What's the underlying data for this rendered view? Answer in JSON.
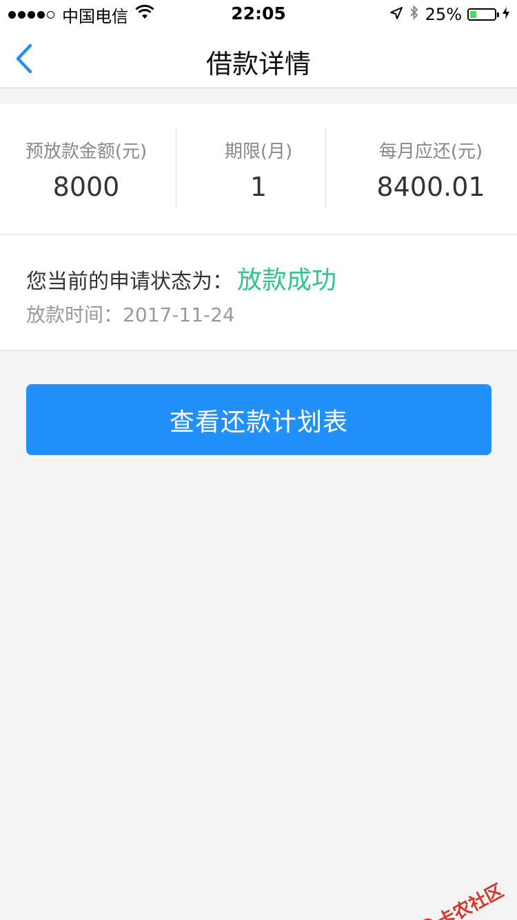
{
  "status_bar": {
    "carrier": "中国电信",
    "time": "22:05",
    "battery_percent": "25%",
    "battery_level": 0.25,
    "signal_bars": 4,
    "signal_total": 5
  },
  "nav": {
    "title": "借款详情"
  },
  "summary": [
    {
      "label": "预放款金额(元)",
      "value": "8000"
    },
    {
      "label": "期限(月)",
      "value": "1"
    },
    {
      "label": "每月应还(元)",
      "value": "8400.01"
    }
  ],
  "status": {
    "label": "您当前的申请状态为：",
    "value": "放款成功",
    "time_label": "放款时间：",
    "time_value": "2017-11-24"
  },
  "button": {
    "label": "查看还款计划表"
  },
  "watermark": {
    "text": "卡农社区"
  },
  "colors": {
    "accent": "#2190fb",
    "success": "#2fc48b",
    "back_arrow": "#1e8ff5",
    "battery": "#4cd964"
  }
}
